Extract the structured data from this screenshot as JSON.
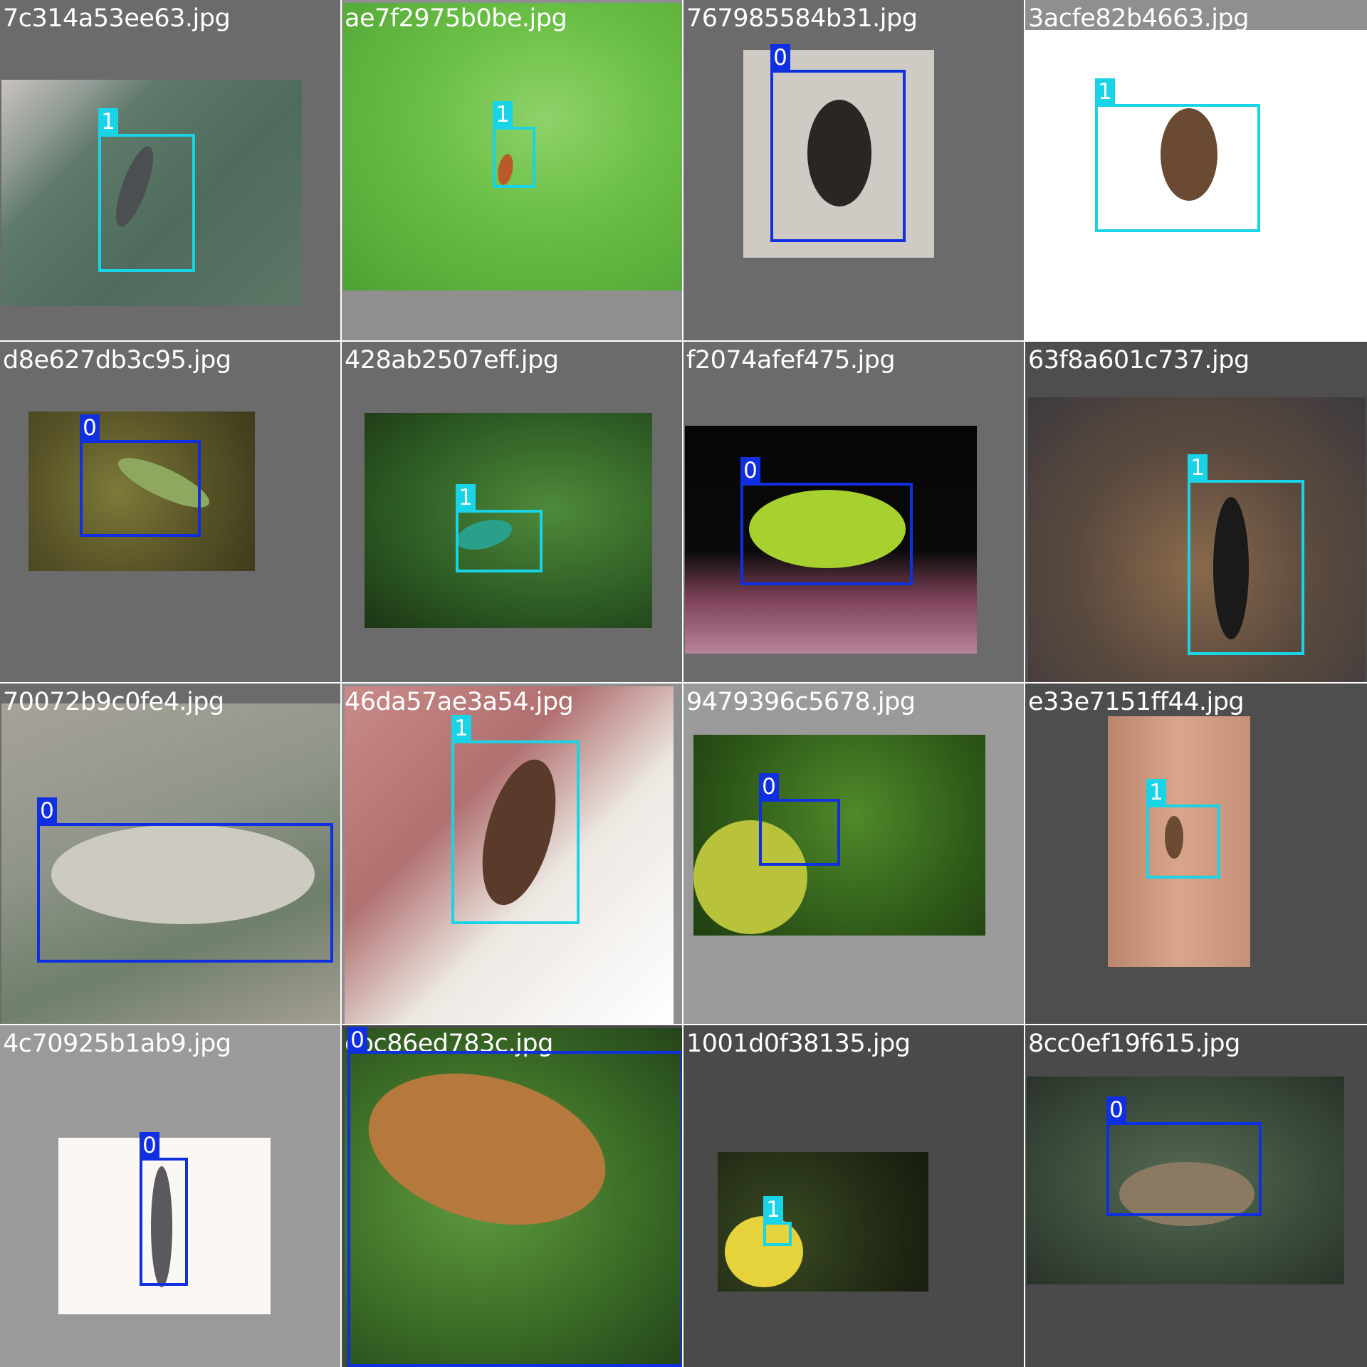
{
  "colors": {
    "class_0": "#0f2fe0",
    "class_1": "#18d4e6",
    "separator": "#ffffff"
  },
  "tiles": [
    {
      "filename": "7c314a53ee63.jpg",
      "labels": [
        "1"
      ]
    },
    {
      "filename": "ae7f2975b0be.jpg",
      "labels": [
        "1"
      ]
    },
    {
      "filename": "767985584b31.jpg",
      "labels": [
        "0"
      ]
    },
    {
      "filename": "3acfe82b4663.jpg",
      "labels": [
        "1"
      ]
    },
    {
      "filename": "d8e627db3c95.jpg",
      "labels": [
        "0"
      ]
    },
    {
      "filename": "428ab2507eff.jpg",
      "labels": [
        "1"
      ]
    },
    {
      "filename": "f2074afef475.jpg",
      "labels": [
        "0"
      ]
    },
    {
      "filename": "63f8a601c737.jpg",
      "labels": [
        "1"
      ]
    },
    {
      "filename": "70072b9c0fe4.jpg",
      "labels": [
        "0"
      ]
    },
    {
      "filename": "46da57ae3a54.jpg",
      "labels": [
        "1"
      ]
    },
    {
      "filename": "9479396c5678.jpg",
      "labels": [
        "0"
      ]
    },
    {
      "filename": "e33e7151ff44.jpg",
      "labels": [
        "1"
      ]
    },
    {
      "filename": "4c70925b1ab9.jpg",
      "labels": [
        "0"
      ]
    },
    {
      "filename": "cbc86ed783c.jpg",
      "labels": [
        "0"
      ]
    },
    {
      "filename": "1001d0f38135.jpg",
      "labels": [
        "1"
      ]
    },
    {
      "filename": "8cc0ef19f615.jpg",
      "labels": [
        "0"
      ]
    }
  ]
}
